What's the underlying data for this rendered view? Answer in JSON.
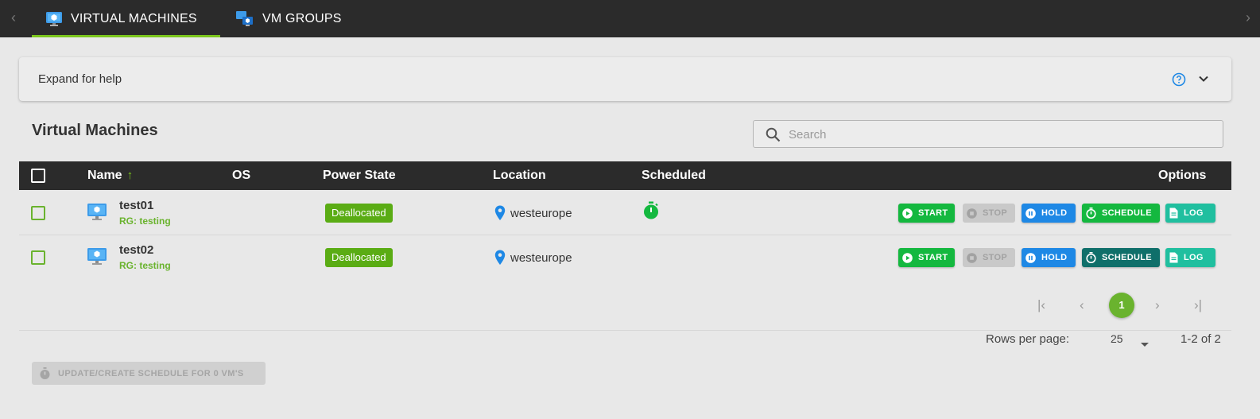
{
  "tabs": [
    {
      "label": "VIRTUAL MACHINES",
      "active": true
    },
    {
      "label": "VM GROUPS",
      "active": false
    }
  ],
  "help": {
    "label": "Expand for help"
  },
  "page": {
    "title": "Virtual Machines"
  },
  "search": {
    "placeholder": "Search",
    "value": ""
  },
  "table": {
    "headers": {
      "name": "Name",
      "os": "OS",
      "power_state": "Power State",
      "location": "Location",
      "scheduled": "Scheduled",
      "options": "Options"
    },
    "sort": {
      "column": "Name",
      "direction": "ascending"
    },
    "rows": [
      {
        "name": "test01",
        "rg": "RG: testing",
        "os": "",
        "power_state": "Deallocated",
        "location": "westeurope",
        "scheduled": true
      },
      {
        "name": "test02",
        "rg": "RG: testing",
        "os": "",
        "power_state": "Deallocated",
        "location": "westeurope",
        "scheduled": false
      }
    ]
  },
  "actions": {
    "start": "START",
    "stop": "STOP",
    "hold": "HOLD",
    "schedule": "SCHEDULE",
    "log": "LOG"
  },
  "pagination": {
    "current": "1",
    "rows_per_page_label": "Rows per page:",
    "rows_per_page": "25",
    "range": "1-2 of 2"
  },
  "bulk": {
    "label": "UPDATE/CREATE SCHEDULE FOR 0 VM'S"
  },
  "colors": {
    "accent": "#7bc61c",
    "header_bg": "#2b2b2b",
    "start": "#14b83f",
    "hold": "#1e88e5",
    "log": "#20bf9f",
    "schedule_alt": "#0f6f6a"
  }
}
